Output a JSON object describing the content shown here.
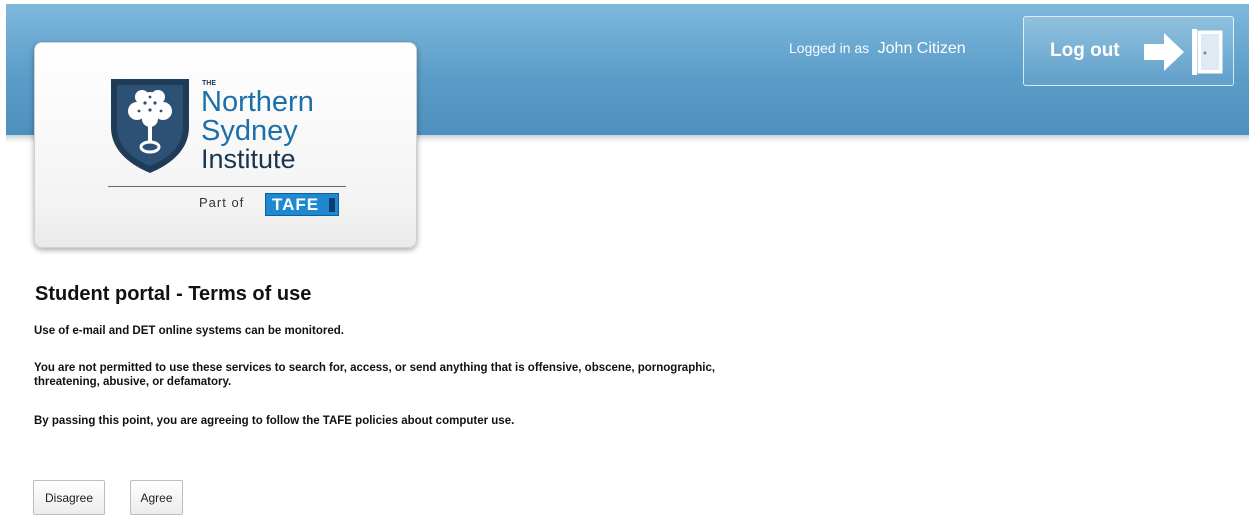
{
  "header": {
    "logged_in_prefix": "Logged in as",
    "user_name": "John Citizen",
    "logout_label": "Log out",
    "logout_icon": "exit-door-icon"
  },
  "logo": {
    "the": "THE",
    "line1": "Northern",
    "line2": "Sydney",
    "line3": "Institute",
    "part_of": "Part of",
    "badge": "TAFE"
  },
  "content": {
    "title": "Student portal - Terms of use",
    "paragraphs": [
      "Use of e-mail and DET online systems can be monitored.",
      "You are not permitted to use these services to search for, access, or send anything that is offensive, obscene, pornographic, threatening, abusive, or defamatory.",
      "By passing this point, you are agreeing to follow the TAFE policies about computer use."
    ]
  },
  "actions": {
    "disagree_label": "Disagree",
    "agree_label": "Agree"
  },
  "colors": {
    "header_blue": "#5b9dc9",
    "logo_blue": "#1d6fa8",
    "tafe_blue": "#1e88d0"
  }
}
